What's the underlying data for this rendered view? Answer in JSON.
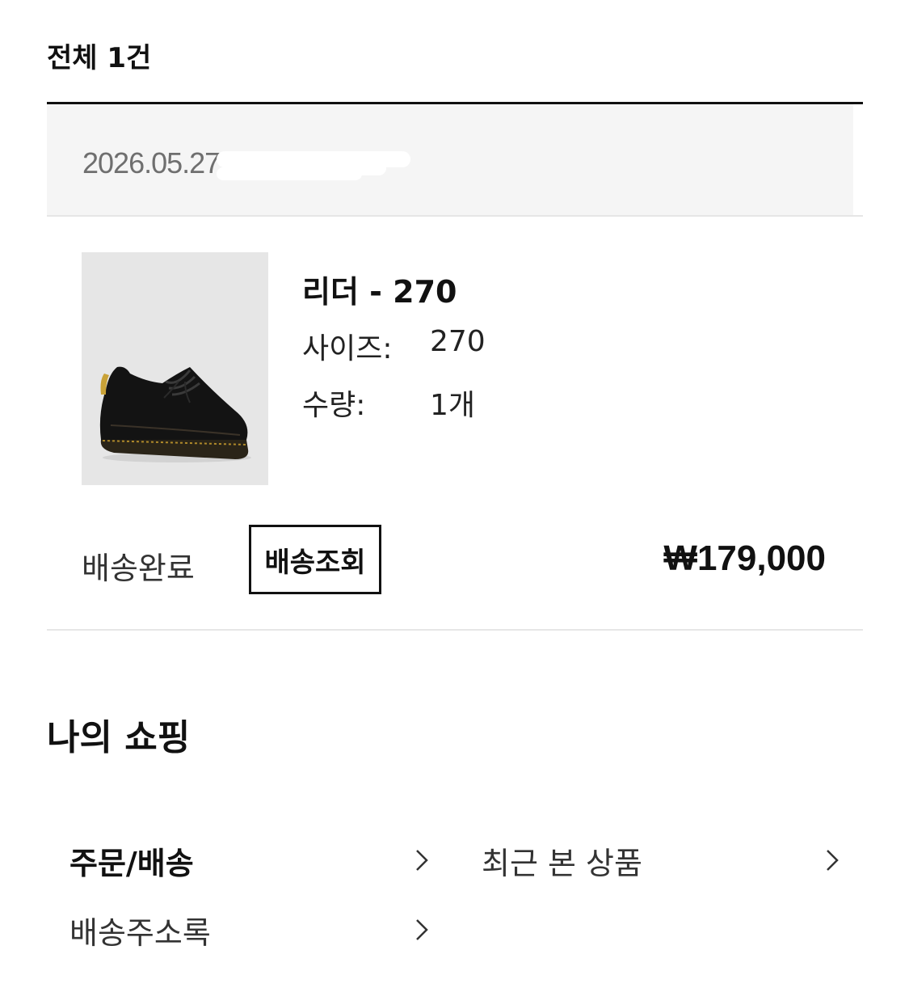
{
  "order_list": {
    "total_label": "전체 1건"
  },
  "order": {
    "date": "2026.05.27",
    "item": {
      "name": "리더 - 270",
      "size_label": "사이즈:",
      "size_value": "270",
      "qty_label": "수량:",
      "qty_value": "1개"
    },
    "status": "배송완료",
    "track_button_label": "배송조회",
    "price": "₩179,000"
  },
  "my_shopping": {
    "title": "나의 쇼핑",
    "menu": [
      {
        "label": "주문/배송",
        "icon": "chevron-right-icon"
      },
      {
        "label": "최근 본 상품",
        "icon": "chevron-right-icon"
      },
      {
        "label": "배송주소록",
        "icon": "chevron-right-icon"
      }
    ]
  },
  "colors": {
    "text": "#111111",
    "muted": "#6f6f6f",
    "header_bg": "#f5f5f5",
    "divider": "#e6e6e6",
    "thumb_bg": "#e6e6e6"
  }
}
